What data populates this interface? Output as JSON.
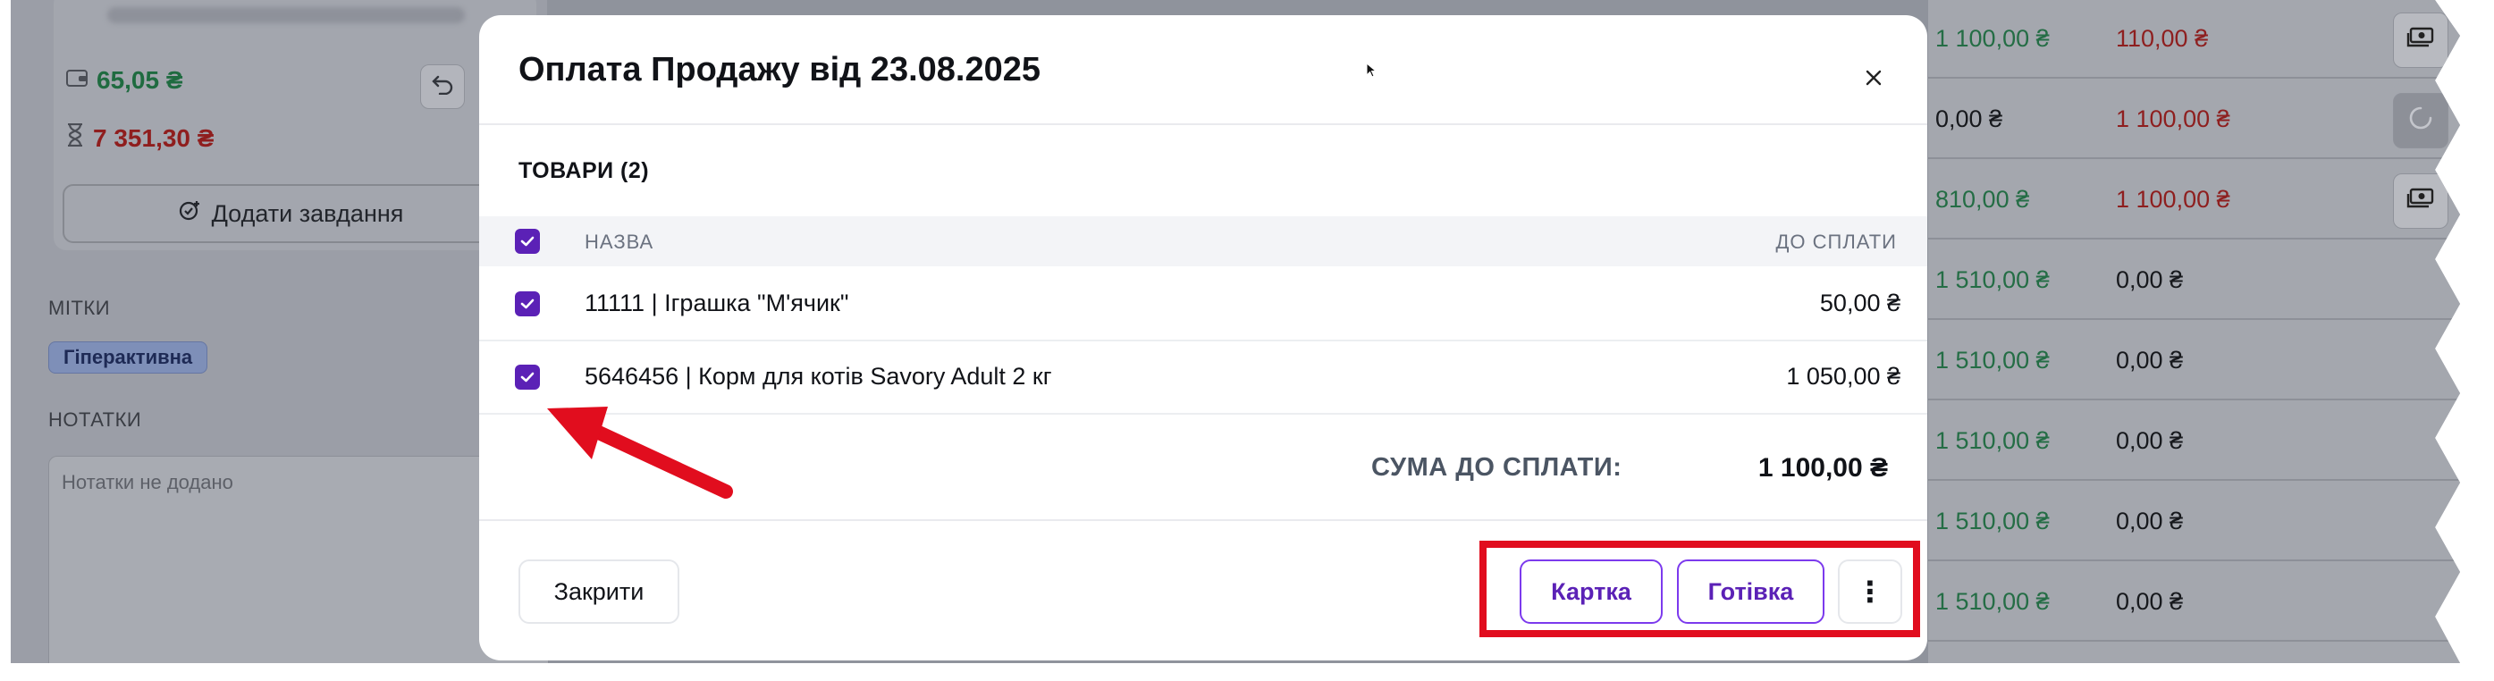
{
  "background": {
    "balances": [
      {
        "value": "65,05 ₴",
        "icon": "wallet-icon"
      },
      {
        "value": "7 351,30 ₴",
        "icon": "hourglass-icon"
      }
    ],
    "add_task_label": "Додати завдання",
    "tags_label": "МІТКИ",
    "tag": "Гіперактивна",
    "notes_label": "НОТАТКИ",
    "notes_placeholder": "Нотатки не додано",
    "right_rows": [
      {
        "paid": "1 100,00 ₴",
        "due": "110,00 ₴",
        "paid_color": "green",
        "due_color": "red",
        "action": "cash-icon"
      },
      {
        "paid": "0,00 ₴",
        "due": "1 100,00 ₴",
        "paid_color": "black",
        "due_color": "red",
        "action": "loading-icon"
      },
      {
        "paid": "810,00 ₴",
        "due": "1 100,00 ₴",
        "paid_color": "green",
        "due_color": "red",
        "action": "cash-icon"
      },
      {
        "paid": "1 510,00 ₴",
        "due": "0,00 ₴",
        "paid_color": "green",
        "due_color": "black",
        "action": ""
      },
      {
        "paid": "1 510,00 ₴",
        "due": "0,00 ₴",
        "paid_color": "green",
        "due_color": "black",
        "action": ""
      },
      {
        "paid": "1 510,00 ₴",
        "due": "0,00 ₴",
        "paid_color": "green",
        "due_color": "black",
        "action": ""
      },
      {
        "paid": "1 510,00 ₴",
        "due": "0,00 ₴",
        "paid_color": "green",
        "due_color": "black",
        "action": ""
      },
      {
        "paid": "1 510,00 ₴",
        "due": "0,00 ₴",
        "paid_color": "green",
        "due_color": "black",
        "action": ""
      }
    ]
  },
  "modal": {
    "title": "Оплата Продажу від 23.08.2025",
    "goods_title": "ТОВАРИ (2)",
    "columns": {
      "name": "НАЗВА",
      "due": "ДО СПЛАТИ"
    },
    "items": [
      {
        "name": "11111 | Іграшка \"М'ячик\"",
        "amount": "50,00 ₴",
        "checked": true
      },
      {
        "name": "5646456 | Корм для котів Savory Adult 2 кг",
        "amount": "1 050,00 ₴",
        "checked": true
      }
    ],
    "sum_label": "СУМА ДО СПЛАТИ:",
    "sum_value": "1 100,00 ₴",
    "buttons": {
      "close": "Закрити",
      "card": "Картка",
      "cash": "Готівка",
      "more": "⋮"
    }
  },
  "colors": {
    "accent": "#5b21b6",
    "highlight": "#e10d1e",
    "green": "#246d45",
    "red": "#8e1f1f"
  }
}
